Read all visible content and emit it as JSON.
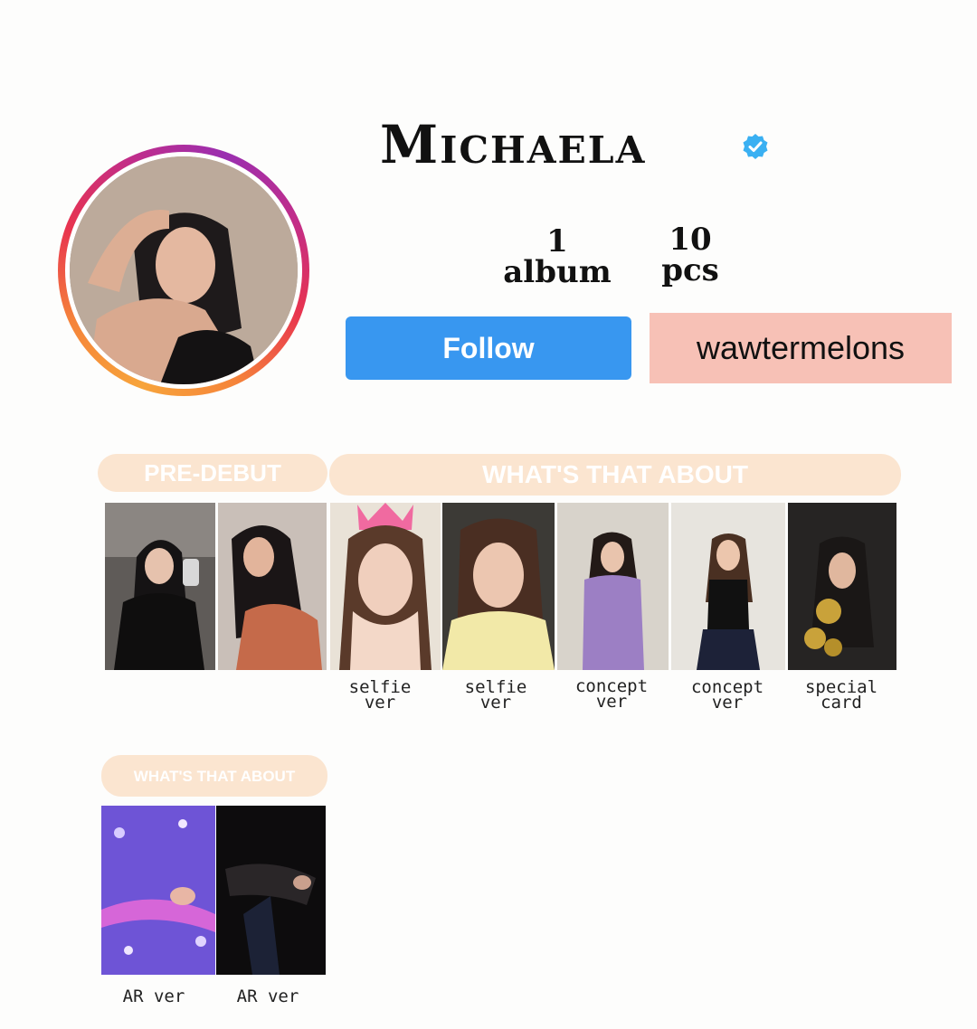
{
  "profile": {
    "name": "Michaela",
    "verified": true,
    "stats": [
      {
        "value": "1",
        "label": "album"
      },
      {
        "value": "10",
        "label": "pcs"
      }
    ],
    "follow_label": "Follow",
    "username": "wawtermelons"
  },
  "sections": [
    {
      "title": "PRE-DEBUT"
    },
    {
      "title": "WHAT'S THAT ABOUT"
    },
    {
      "title": "WHAT'S THAT ABOUT"
    }
  ],
  "cards_row1": [
    {
      "caption": ""
    },
    {
      "caption": ""
    },
    {
      "caption": "selfie ver"
    },
    {
      "caption": "selfie ver"
    },
    {
      "caption": "concept ver"
    },
    {
      "caption": "concept ver"
    },
    {
      "caption": "special card"
    }
  ],
  "cards_row2": [
    {
      "caption": "AR ver"
    },
    {
      "caption": "AR ver"
    }
  ],
  "colors": {
    "follow_blue": "#3897f0",
    "username_pink": "#f7c1b6",
    "pill_peach": "#fbe5d0",
    "verified_blue": "#3ab0f2"
  }
}
